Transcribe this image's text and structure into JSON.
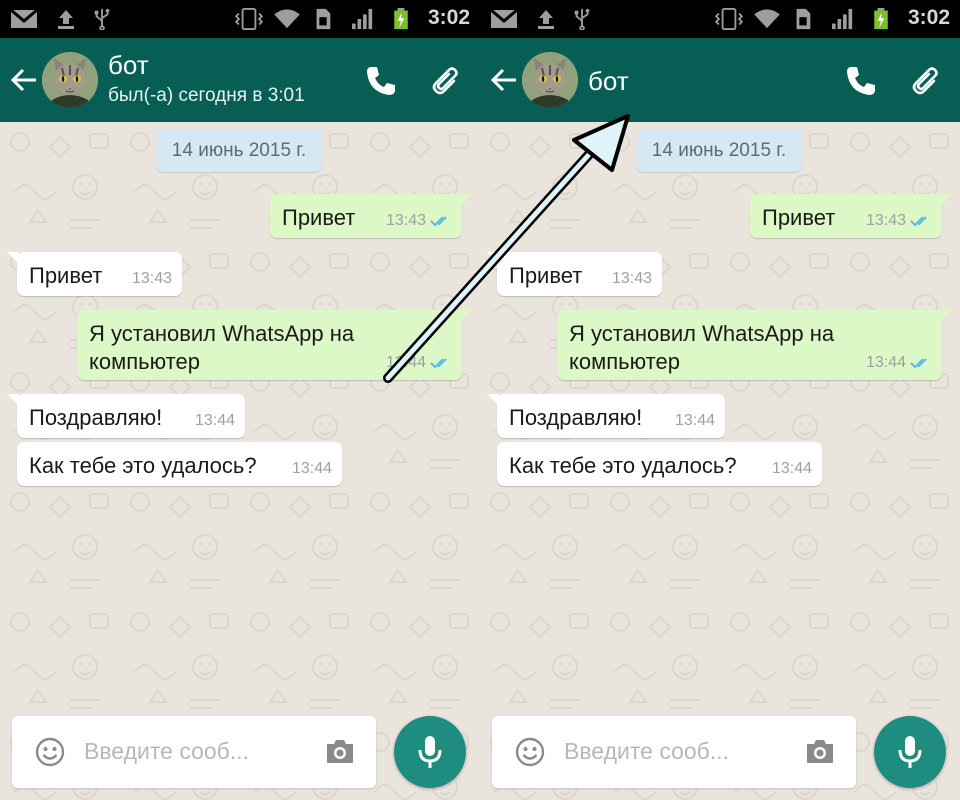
{
  "status_bar": {
    "time": "3:02",
    "icons": [
      "gmail-icon",
      "upload-icon",
      "usb-icon",
      "vibrate-icon",
      "wifi-icon",
      "sim-icon",
      "signal-icon",
      "battery-charging-icon"
    ]
  },
  "header": {
    "contact_name": "бот",
    "last_seen": "был(-а) сегодня в 3:01",
    "icons": [
      "back-arrow-icon",
      "avatar-cat",
      "phone-icon",
      "paperclip-icon"
    ]
  },
  "chat": {
    "date_chip": "14 июнь 2015 г.",
    "messages": [
      {
        "direction": "out",
        "text": "Привет",
        "time": "13:43",
        "status": "read-double-tick"
      },
      {
        "direction": "in",
        "text": "Привет",
        "time": "13:43"
      },
      {
        "direction": "out",
        "text": "Я установил WhatsApp на компьютер",
        "time": "13:44",
        "status": "read-double-tick"
      },
      {
        "direction": "in",
        "text": "Поздравляю!",
        "time": "13:44"
      },
      {
        "direction": "in",
        "text": "Как тебе это удалось?",
        "time": "13:44"
      }
    ]
  },
  "composer": {
    "placeholder": "Введите сооб...",
    "icons": [
      "emoji-icon",
      "camera-icon",
      "mic-icon"
    ]
  },
  "colors": {
    "header": "#075e54",
    "outgoing_bubble": "#dcf8c6",
    "incoming_bubble": "#ffffff",
    "date_chip": "#d5e9f5",
    "mic_button": "#1e8c7e",
    "read_ticks": "#4fb6ec"
  },
  "screens": [
    "with-last-seen",
    "last-seen-hidden"
  ]
}
